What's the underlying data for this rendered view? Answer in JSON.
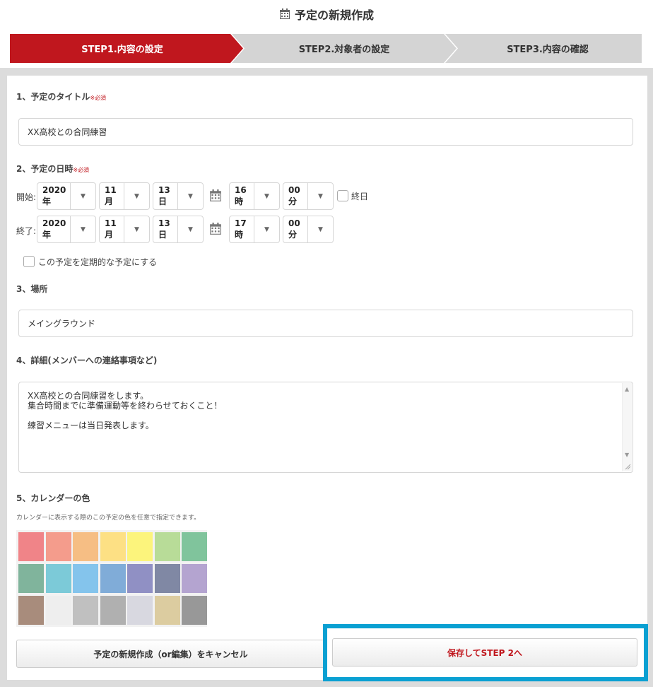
{
  "header": {
    "title": "予定の新規作成",
    "icon": "calendar-icon"
  },
  "steps": [
    {
      "label": "STEP1.内容の設定",
      "active": true
    },
    {
      "label": "STEP2.対象者の設定",
      "active": false
    },
    {
      "label": "STEP3.内容の確認",
      "active": false
    }
  ],
  "colors": {
    "accent": "#c0171e",
    "inactive_step": "#d4d4d4",
    "highlight": "#0aa0d2"
  },
  "title_section": {
    "label": "1、予定のタイトル",
    "required": "※必須",
    "value": "XX高校との合同練習"
  },
  "datetime_section": {
    "label": "2、予定の日時",
    "required": "※必須",
    "start": {
      "label": "開始:",
      "year": "2020年",
      "month": "11月",
      "day": "13日",
      "hour": "16時",
      "minute": "00分"
    },
    "end": {
      "label": "終了:",
      "year": "2020年",
      "month": "11月",
      "day": "13日",
      "hour": "17時",
      "minute": "00分"
    },
    "all_day_label": "終日",
    "recurring_label": "この予定を定期的な予定にする"
  },
  "place_section": {
    "label": "3、場所",
    "value": "メイングラウンド"
  },
  "details_section": {
    "label": "4、詳細(メンバーへの連絡事項など)",
    "lines": [
      "XX高校との合同練習をします。",
      "集合時間までに準備運動等を終わらせておくこと！",
      "",
      "練習メニューは当日発表します。"
    ]
  },
  "color_section": {
    "label": "5、カレンダーの色",
    "hint": "カレンダーに表示する際のこの予定の色を任意で指定できます。",
    "swatches": [
      "#f08488",
      "#f49c8c",
      "#f6be84",
      "#fde084",
      "#fcf47c",
      "#b8dc98",
      "#80c49c",
      "#80b49c",
      "#7ccad8",
      "#84c4ec",
      "#80acd8",
      "#9090c4",
      "#8088a4",
      "#b4a4d0",
      "#a88c7c",
      "#eeeeee",
      "#c0c0c0",
      "#b0b0b0",
      "#d8d8e0",
      "#dccca0",
      "#989898"
    ]
  },
  "buttons": {
    "cancel": "予定の新規作成（or編集）をキャンセル",
    "save": "保存してSTEP 2へ"
  }
}
